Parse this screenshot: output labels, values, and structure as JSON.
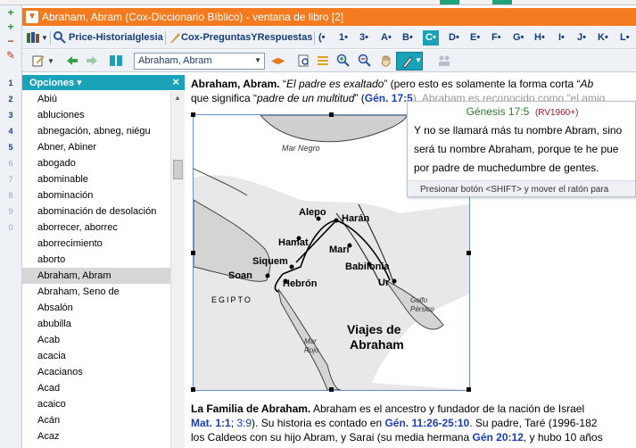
{
  "window": {
    "title": "Abraham, Abram (Cox-Diccionario Bíblico) - ventana de libro [2]"
  },
  "left_toolbar": {
    "numbers": [
      "1",
      "2",
      "3",
      "4",
      "5",
      "6",
      "7",
      "8",
      "9",
      "0"
    ]
  },
  "toolbar1": {
    "book1": "Price-HistoriaIglesia",
    "book2": "Cox-PreguntasYRespuestas",
    "letters": [
      "(•",
      "1•",
      "3•",
      "A•",
      "B•",
      "C•",
      "D•",
      "E•",
      "F•",
      "G•",
      "H•",
      "I•",
      "J•",
      "K•",
      "L•"
    ],
    "selected_letter": "C•"
  },
  "toolbar2": {
    "address_value": "Abraham, Abram"
  },
  "sidebar": {
    "header": "Opciones",
    "items": [
      "Abiú",
      "abluciones",
      "abnegación, abneg, niégu",
      "Abner, Abiner",
      "abogado",
      "abominable",
      "abominación",
      "abominación de desolación",
      "aborrecer, aborrec",
      "aborrecimiento",
      "aborto",
      "Abraham, Abram",
      "Abraham, Seno de",
      "Absalón",
      "abubilla",
      "Acab",
      "acacia",
      "Acacianos",
      "Acad",
      "acaico",
      "Acán",
      "Acaz"
    ],
    "selected": "Abraham, Abram"
  },
  "content": {
    "heading": "Abraham, Abram.",
    "line1_a": " “",
    "line1_italic": "El padre es exaltado",
    "line1_b": "” (pero esto es solamente la forma corta “",
    "line1_c": "Ab",
    "line2_a": "que significa “",
    "line2_italic": "padre de un multitud",
    "line2_b": "” (",
    "line2_ref": "Gén. 17:5",
    "line2_c": "). Abraham es reconocido como “el amig",
    "map": {
      "labels": [
        "Mar Negro",
        "Alepo",
        "Harán",
        "Hamat",
        "Mari",
        "Babilonia",
        "Siquem",
        "Soan",
        "Hebrón",
        "Ur",
        "EGIPTO",
        "Golfo Pérsico",
        "Mar Rojo",
        "Viajes de",
        "Abraham"
      ]
    },
    "para2_heading": "La Familia de Abraham.",
    "para2_a": " Abraham es el ancestro y fundador de la nación de Israel",
    "para2_line2_ref1": "Mat. 1:1",
    "para2_line2_sep": "; ",
    "para2_line2_ref2": "3:9",
    "para2_line2_a": "). Su historia es contado en ",
    "para2_line2_ref3": "Gén. 11:26-25:10",
    "para2_line2_b": ". Su padre, Taré (1996-182",
    "para2_line3_a": "los Caldeos con su hijo Abram, y Sarai (su media hermana ",
    "para2_line3_ref": "Gén 20:12",
    "para2_line3_b": ", y hubo 10 años"
  },
  "tooltip": {
    "reference": "Génesis 17:5",
    "version": "(RV1960+)",
    "lines": [
      "Y no se llamará más tu nombre Abram, sino",
      "será tu nombre Abraham, porque te he pue",
      "por padre de muchedumbre de gentes."
    ],
    "footer": "Presionar botón <SHIFT> y mover el ratón para"
  },
  "colors": {
    "title_bar": "#f37a1f",
    "accent": "#1aa3b8",
    "link": "#1a3fb0",
    "tooltip_ref": "#2a7a2a",
    "tooltip_version": "#a0192a"
  }
}
